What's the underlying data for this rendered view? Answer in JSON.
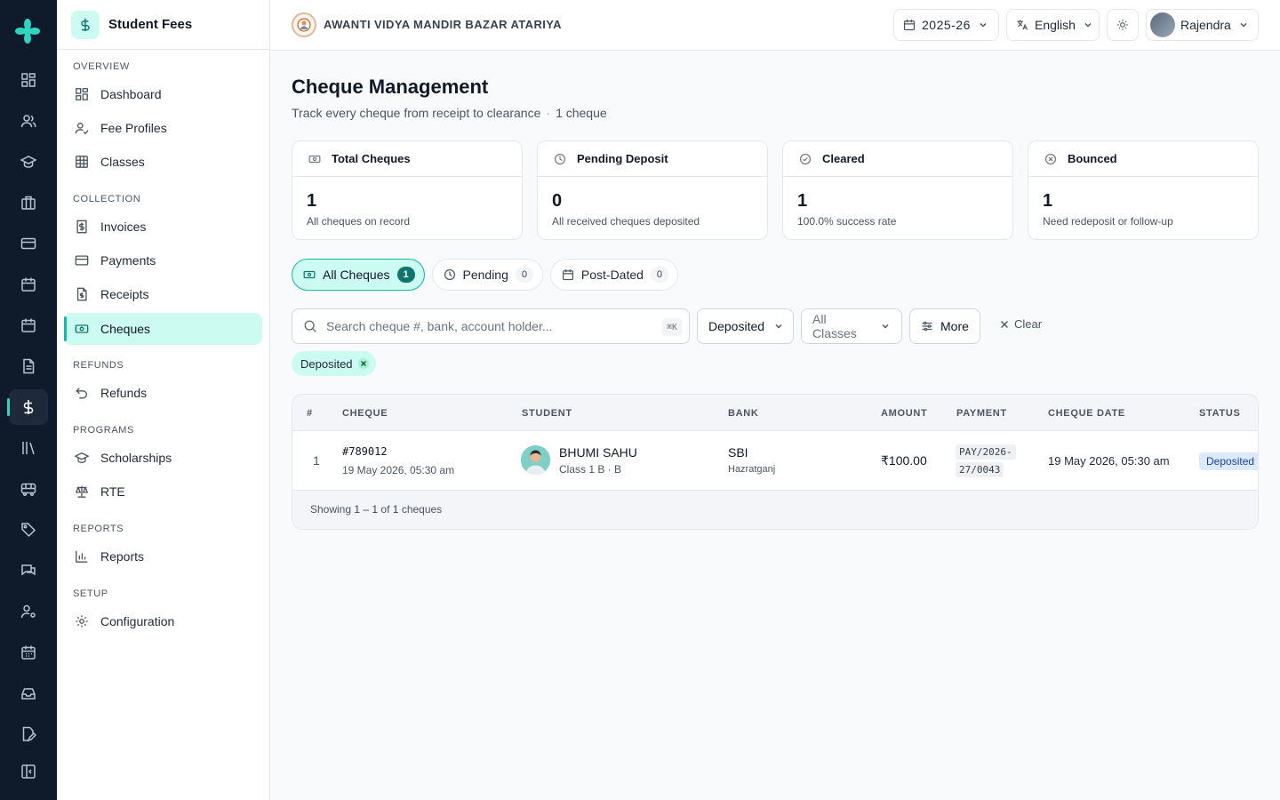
{
  "app": {
    "title": "Student Fees"
  },
  "school": {
    "name": "AWANTI VIDYA MANDIR BAZAR ATARIYA"
  },
  "header": {
    "year": "2025-26",
    "language": "English",
    "user": "Rajendra"
  },
  "sidebar": {
    "sections": [
      {
        "title": "OVERVIEW",
        "items": [
          {
            "label": "Dashboard",
            "icon": "dashboard-icon"
          },
          {
            "label": "Fee Profiles",
            "icon": "user-check-icon"
          },
          {
            "label": "Classes",
            "icon": "grid-icon"
          }
        ]
      },
      {
        "title": "COLLECTION",
        "items": [
          {
            "label": "Invoices",
            "icon": "invoice-icon"
          },
          {
            "label": "Payments",
            "icon": "card-icon"
          },
          {
            "label": "Receipts",
            "icon": "receipt-icon"
          },
          {
            "label": "Cheques",
            "icon": "cheque-icon",
            "active": true
          }
        ]
      },
      {
        "title": "REFUNDS",
        "items": [
          {
            "label": "Refunds",
            "icon": "undo-icon"
          }
        ]
      },
      {
        "title": "PROGRAMS",
        "items": [
          {
            "label": "Scholarships",
            "icon": "graduation-cap-icon"
          },
          {
            "label": "RTE",
            "icon": "scale-icon"
          }
        ]
      },
      {
        "title": "REPORTS",
        "items": [
          {
            "label": "Reports",
            "icon": "bar-chart-icon"
          }
        ]
      },
      {
        "title": "SETUP",
        "items": [
          {
            "label": "Configuration",
            "icon": "gear-icon"
          }
        ]
      }
    ]
  },
  "rail": {
    "icons": [
      "dashboard-icon",
      "users-icon",
      "graduation-cap-icon",
      "building-icon",
      "card-icon",
      "calendar-icon",
      "calendar-icon",
      "document-icon",
      "dollar-icon",
      "library-icon",
      "bus-icon",
      "tag-icon",
      "chat-icon",
      "user-settings-icon",
      "calendar-grid-icon",
      "inbox-icon",
      "file-edit-icon",
      "panel-collapse-icon"
    ],
    "active_index": 8
  },
  "page": {
    "title": "Cheque Management",
    "subtitle": "Track every cheque from receipt to clearance",
    "count": "1 cheque"
  },
  "stats": [
    {
      "title": "Total Cheques",
      "value": "1",
      "note": "All cheques on record",
      "icon": "cheque-icon"
    },
    {
      "title": "Pending Deposit",
      "value": "0",
      "note": "All received cheques deposited",
      "icon": "clock-icon"
    },
    {
      "title": "Cleared",
      "value": "1",
      "note": "100.0% success rate",
      "icon": "check-circle-icon"
    },
    {
      "title": "Bounced",
      "value": "1",
      "note": "Need redeposit or follow-up",
      "icon": "x-circle-icon"
    }
  ],
  "tabs": [
    {
      "label": "All Cheques",
      "count": "1",
      "active": true
    },
    {
      "label": "Pending",
      "count": "0"
    },
    {
      "label": "Post-Dated",
      "count": "0"
    }
  ],
  "filters": {
    "search_placeholder": "Search cheque #, bank, account holder...",
    "shortcut": "⌘K",
    "status": "Deposited",
    "class": "All Classes",
    "more": "More",
    "clear": "Clear",
    "active_chip": "Deposited"
  },
  "table": {
    "columns": [
      "#",
      "CHEQUE",
      "STUDENT",
      "BANK",
      "AMOUNT",
      "PAYMENT",
      "CHEQUE DATE",
      "STATUS"
    ],
    "rows": [
      {
        "index": "1",
        "cheque_no": "#789012",
        "cheque_received": "19 May 2026, 05:30 am",
        "student_name": "BHUMI SAHU",
        "student_class": "Class 1 B · B",
        "bank": "SBI",
        "branch": "Hazratganj",
        "amount": "₹100.00",
        "payment_ref_1": "PAY/2026-",
        "payment_ref_2": "27/0043",
        "cheque_date": "19 May 2026, 05:30 am",
        "status": "Deposited"
      }
    ],
    "footer": {
      "prefix": "Showing",
      "range": "1 – 1",
      "of": "of",
      "total": "1",
      "suffix": "cheques"
    }
  },
  "colors": {
    "accent": "#14b8a6",
    "accent_soft": "#ccfbf1",
    "rail_bg": "#0f1a2a",
    "status_deposited": "#dbeafe"
  }
}
